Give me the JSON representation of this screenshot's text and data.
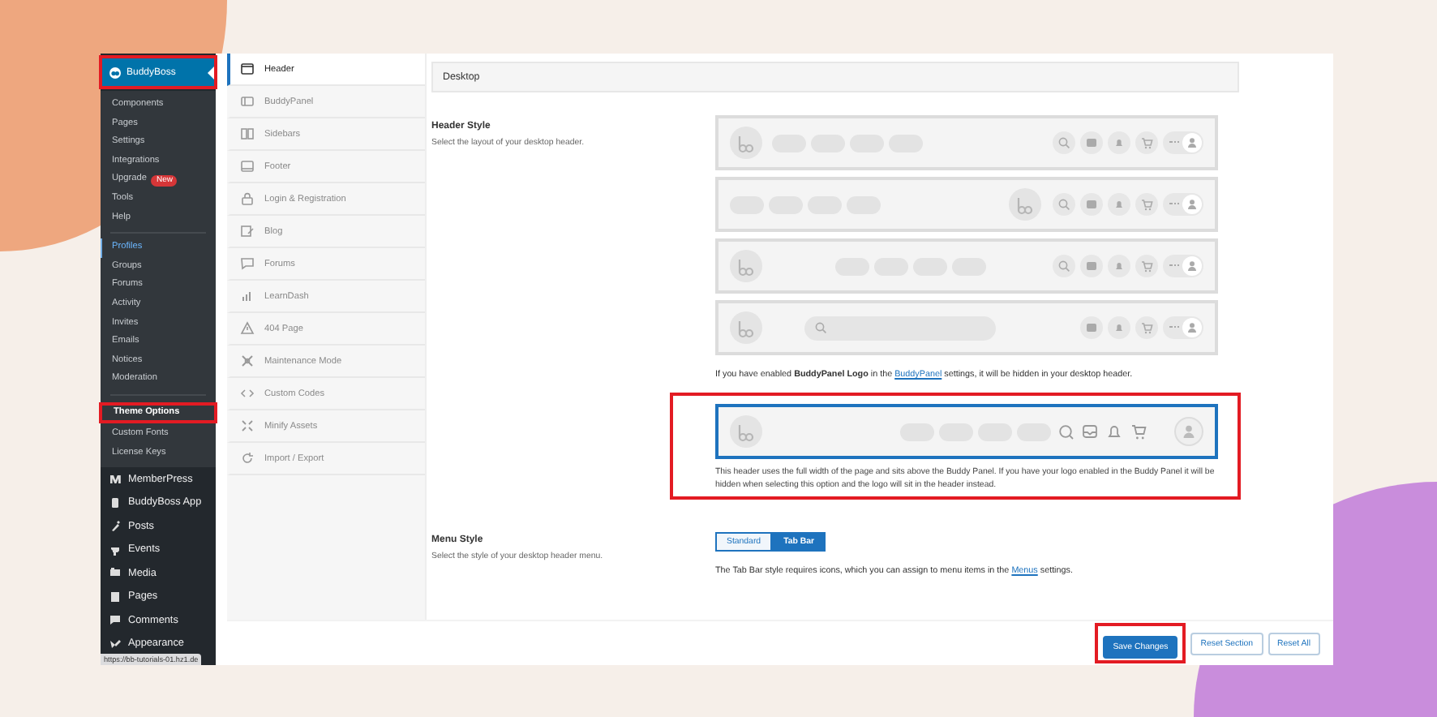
{
  "wp_menu": {
    "current": {
      "label": "BuddyBoss",
      "highlighted": true
    },
    "submenu_groups": [
      {
        "items": [
          {
            "label": "Components",
            "selected": false,
            "highlighted": false
          },
          {
            "label": "Pages",
            "selected": false,
            "highlighted": false
          },
          {
            "label": "Settings",
            "selected": false,
            "highlighted": false
          },
          {
            "label": "Integrations",
            "selected": false,
            "highlighted": false
          },
          {
            "label": "Upgrade",
            "badge": "New",
            "selected": false,
            "highlighted": false
          },
          {
            "label": "Tools",
            "selected": false,
            "highlighted": false
          },
          {
            "label": "Help",
            "selected": false,
            "highlighted": false
          }
        ]
      },
      {
        "items": [
          {
            "label": "Profiles",
            "selected": true,
            "highlighted": false
          },
          {
            "label": "Groups",
            "selected": false,
            "highlighted": false
          },
          {
            "label": "Forums",
            "selected": false,
            "highlighted": false
          },
          {
            "label": "Activity",
            "selected": false,
            "highlighted": false
          },
          {
            "label": "Invites",
            "selected": false,
            "highlighted": false
          },
          {
            "label": "Emails",
            "selected": false,
            "highlighted": false
          },
          {
            "label": "Notices",
            "selected": false,
            "highlighted": false
          },
          {
            "label": "Moderation",
            "selected": false,
            "highlighted": false
          }
        ]
      },
      {
        "items": [
          {
            "label": "Theme Options",
            "selected": false,
            "highlighted": true
          },
          {
            "label": "Custom Fonts",
            "selected": false,
            "highlighted": false
          },
          {
            "label": "License Keys",
            "selected": false,
            "highlighted": false
          }
        ]
      }
    ],
    "items": [
      {
        "label": "MemberPress"
      },
      {
        "label": "BuddyBoss App"
      },
      {
        "label": "Posts"
      },
      {
        "label": "Events"
      },
      {
        "label": "Media"
      },
      {
        "label": "Pages"
      },
      {
        "label": "Comments"
      },
      {
        "label": "Appearance"
      }
    ]
  },
  "status_url": "https://bb-tutorials-01.hz1.de",
  "settings_tabs": [
    {
      "label": "Header",
      "selected": true
    },
    {
      "label": "BuddyPanel",
      "selected": false
    },
    {
      "label": "Sidebars",
      "selected": false
    },
    {
      "label": "Footer",
      "selected": false
    },
    {
      "label": "Login & Registration",
      "selected": false
    },
    {
      "label": "Blog",
      "selected": false
    },
    {
      "label": "Forums",
      "selected": false
    },
    {
      "label": "LearnDash",
      "selected": false
    },
    {
      "label": "404 Page",
      "selected": false
    },
    {
      "label": "Maintenance Mode",
      "selected": false
    },
    {
      "label": "Custom Codes",
      "selected": false
    },
    {
      "label": "Minify Assets",
      "selected": false
    },
    {
      "label": "Import / Export",
      "selected": false
    }
  ],
  "section_title": "Desktop",
  "header_style": {
    "label": "Header Style",
    "description": "Select the layout of your desktop header.",
    "options": [
      {
        "kind": "logo-left",
        "selected": false
      },
      {
        "kind": "logo-center",
        "selected": false
      },
      {
        "kind": "menu-center",
        "selected": false
      },
      {
        "kind": "search",
        "selected": false
      }
    ],
    "note": {
      "before": "If you have enabled **BuddyPanel Logo** in the ",
      "link": "BuddyPanel",
      "after": " settings, it will be hidden in your desktop header."
    },
    "full_width": {
      "kind": "full-width",
      "selected": true,
      "highlighted": true,
      "description": "This header uses the full width of the page and sits above the Buddy Panel. If you have your logo enabled in the Buddy Panel it will be hidden when selecting this option and the logo will sit in the header instead."
    }
  },
  "menu_style": {
    "label": "Menu Style",
    "description": "Select the style of your desktop header menu.",
    "choices": [
      {
        "label": "Standard",
        "selected": false
      },
      {
        "label": "Tab Bar",
        "selected": true
      }
    ],
    "note": {
      "before": "The Tab Bar style requires icons, which you can assign to menu items in the ",
      "link": "Menus",
      "after": " settings."
    }
  },
  "actions": [
    {
      "label": "Save Changes",
      "kind": "primary",
      "highlighted": true
    },
    {
      "label": "Reset Section",
      "kind": "secondary",
      "highlighted": false
    },
    {
      "label": "Reset All",
      "kind": "secondary",
      "highlighted": false
    }
  ]
}
